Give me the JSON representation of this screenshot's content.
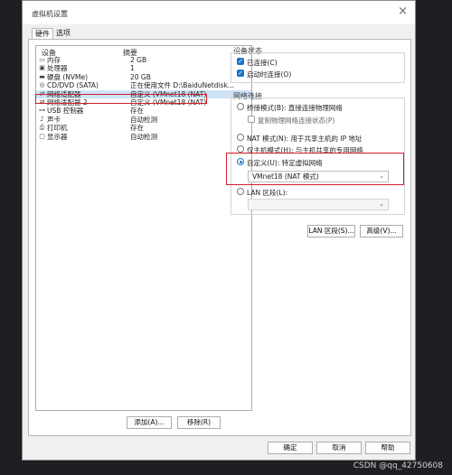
{
  "window": {
    "title": "虚拟机设置",
    "close_icon": "×"
  },
  "tabs": [
    {
      "label": "硬件",
      "active": true
    },
    {
      "label": "选项",
      "active": false
    }
  ],
  "device_list": {
    "headers": {
      "device": "设备",
      "summary": "摘要"
    },
    "rows": [
      {
        "icon": "memory-icon",
        "glyph": "▭",
        "name": "内存",
        "summary": "2 GB"
      },
      {
        "icon": "cpu-icon",
        "glyph": "▣",
        "name": "处理器",
        "summary": "1"
      },
      {
        "icon": "disk-icon",
        "glyph": "▬",
        "name": "硬盘 (NVMe)",
        "summary": "20 GB"
      },
      {
        "icon": "cd-icon",
        "glyph": "◎",
        "name": "CD/DVD (SATA)",
        "summary": "正在使用文件 D:\\BaiduNetdisk..."
      },
      {
        "icon": "network-icon",
        "glyph": "⇄",
        "name": "网络适配器",
        "summary": "自定义 (VMnet18 (NAT)",
        "selected": true
      },
      {
        "icon": "network-icon",
        "glyph": "⇄",
        "name": "网络适配器 2",
        "summary": "自定义 (VMnet18 (NAT)"
      },
      {
        "icon": "usb-icon",
        "glyph": "⊶",
        "name": "USB 控制器",
        "summary": "存在"
      },
      {
        "icon": "sound-icon",
        "glyph": "♪",
        "name": "声卡",
        "summary": "自动检测"
      },
      {
        "icon": "printer-icon",
        "glyph": "⎙",
        "name": "打印机",
        "summary": "存在"
      },
      {
        "icon": "display-icon",
        "glyph": "▢",
        "name": "显示器",
        "summary": "自动检测"
      }
    ],
    "add_button": "添加(A)...",
    "remove_button": "移除(R)"
  },
  "device_status": {
    "label": "设备状态",
    "connected": "已连接(C)",
    "connect_at_power_on": "启动时连接(O)"
  },
  "network_connection": {
    "label": "网络连接",
    "bridged": "桥接模式(B): 直接连接物理网络",
    "replicate": "复制物理网络连接状态(P)",
    "nat": "NAT 模式(N): 用于共享主机的 IP 地址",
    "host_only": "仅主机模式(H): 与主机共享的专用网络",
    "custom": "自定义(U): 特定虚拟网络",
    "custom_value": "VMnet18 (NAT 模式)",
    "lan": "LAN 区段(L):",
    "lan_value": ""
  },
  "side_buttons": {
    "lan_segments": "LAN 区段(S)...",
    "advanced": "高级(V)..."
  },
  "footer": {
    "ok": "确定",
    "cancel": "取消",
    "help": "帮助"
  },
  "watermark": "CSDN @qq_42750608",
  "colors": {
    "highlight_red": "#d0202a",
    "accent_blue": "#1a73c6"
  }
}
